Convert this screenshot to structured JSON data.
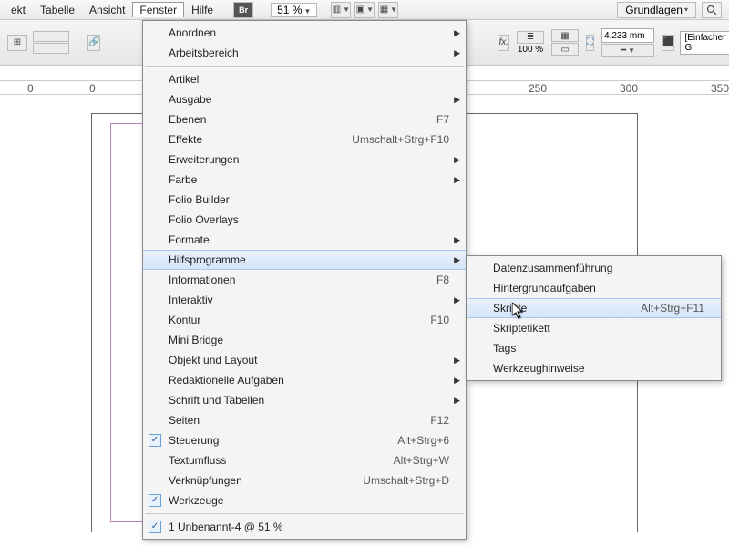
{
  "menubar": {
    "items": [
      "ekt",
      "Tabelle",
      "Ansicht",
      "Fenster",
      "Hilfe"
    ],
    "active_index": 3,
    "zoom": "51 %",
    "workspace": "Grundlagen",
    "br_label": "Br"
  },
  "toolbar": {
    "stroke_value": "4,233 mm",
    "pct": "100 %",
    "fx_label": "fx.",
    "style_label": "[Einfacher G"
  },
  "ruler": {
    "ticks": [
      {
        "pos": 30,
        "label": "0"
      },
      {
        "pos": 98,
        "label": "0"
      },
      {
        "pos": 580,
        "label": "250"
      },
      {
        "pos": 680,
        "label": "300"
      },
      {
        "pos": 780,
        "label": "350"
      }
    ]
  },
  "main_menu": [
    {
      "label": "Anordnen",
      "submenu": true
    },
    {
      "label": "Arbeitsbereich",
      "submenu": true
    },
    {
      "sep": true
    },
    {
      "label": "Artikel"
    },
    {
      "label": "Ausgabe",
      "submenu": true
    },
    {
      "label": "Ebenen",
      "shortcut": "F7"
    },
    {
      "label": "Effekte",
      "shortcut": "Umschalt+Strg+F10"
    },
    {
      "label": "Erweiterungen",
      "submenu": true
    },
    {
      "label": "Farbe",
      "submenu": true
    },
    {
      "label": "Folio Builder"
    },
    {
      "label": "Folio Overlays"
    },
    {
      "label": "Formate",
      "submenu": true
    },
    {
      "label": "Hilfsprogramme",
      "submenu": true,
      "hover": true
    },
    {
      "label": "Informationen",
      "shortcut": "F8"
    },
    {
      "label": "Interaktiv",
      "submenu": true
    },
    {
      "label": "Kontur",
      "shortcut": "F10"
    },
    {
      "label": "Mini Bridge"
    },
    {
      "label": "Objekt und Layout",
      "submenu": true
    },
    {
      "label": "Redaktionelle Aufgaben",
      "submenu": true
    },
    {
      "label": "Schrift und Tabellen",
      "submenu": true
    },
    {
      "label": "Seiten",
      "shortcut": "F12"
    },
    {
      "label": "Steuerung",
      "shortcut": "Alt+Strg+6",
      "checked": true
    },
    {
      "label": "Textumfluss",
      "shortcut": "Alt+Strg+W"
    },
    {
      "label": "Verknüpfungen",
      "shortcut": "Umschalt+Strg+D"
    },
    {
      "label": "Werkzeuge",
      "checked": true
    },
    {
      "sep": true
    },
    {
      "label": "1 Unbenannt-4 @ 51 %",
      "checked": true
    }
  ],
  "sub_menu": [
    {
      "label": "Datenzusammenführung"
    },
    {
      "label": "Hintergrundaufgaben"
    },
    {
      "label": "Skripte",
      "shortcut": "Alt+Strg+F11",
      "hover": true
    },
    {
      "label": "Skriptetikett"
    },
    {
      "label": "Tags"
    },
    {
      "label": "Werkzeughinweise"
    }
  ]
}
